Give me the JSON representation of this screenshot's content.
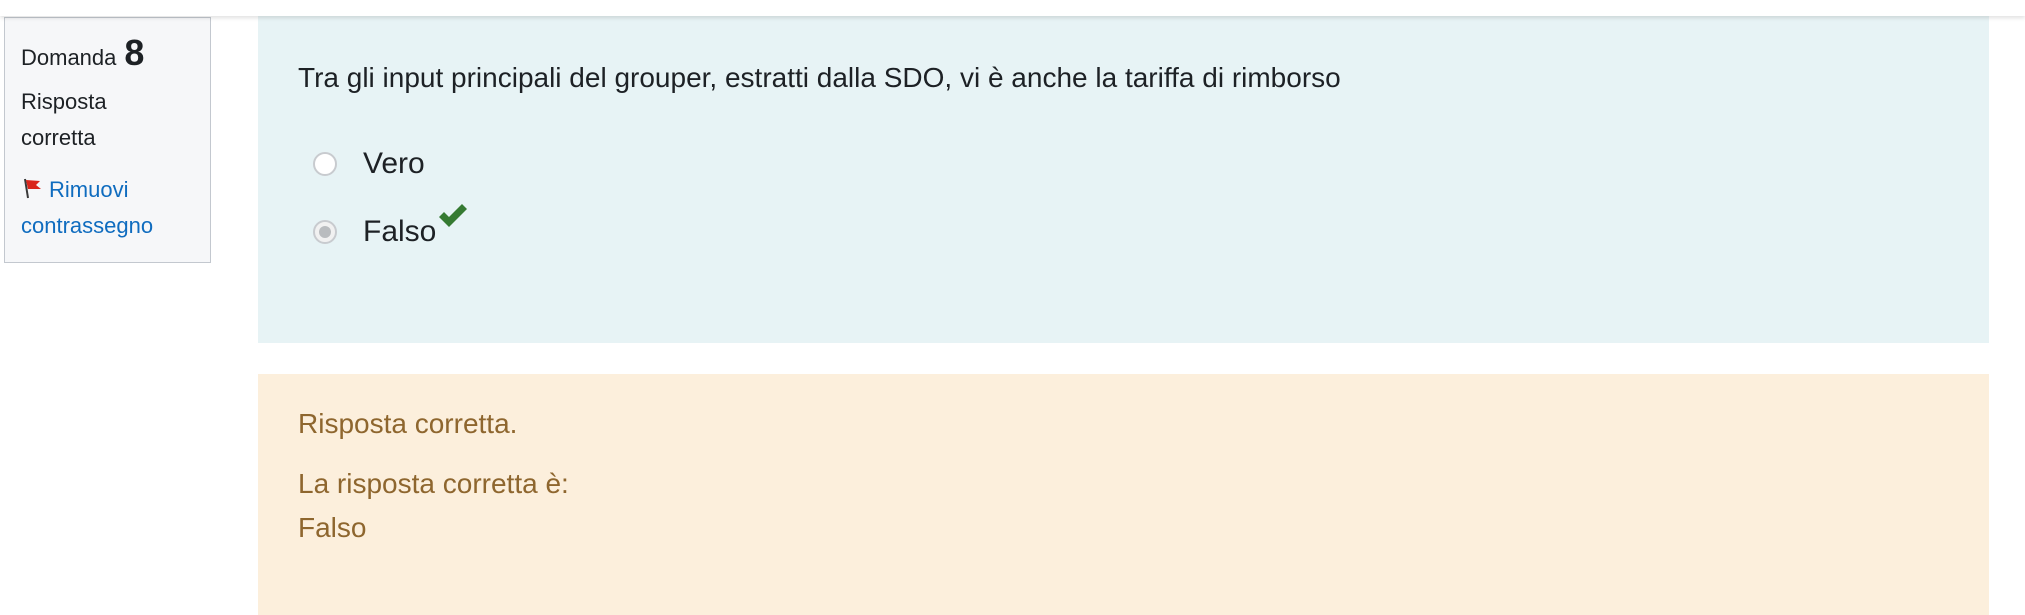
{
  "question_info": {
    "label": "Domanda",
    "number": "8",
    "state": "Risposta corretta",
    "flag_label": "Rimuovi contrassegno"
  },
  "question": {
    "text": "Tra gli input principali del grouper, estratti dalla SDO, vi è anche la tariffa di rimborso",
    "answers": [
      {
        "label": "Vero",
        "selected": false,
        "correct_mark": false
      },
      {
        "label": "Falso",
        "selected": true,
        "correct_mark": true
      }
    ]
  },
  "feedback": {
    "general": "Risposta corretta.",
    "right_answer_label": "La risposta corretta è:",
    "right_answer_value": "Falso"
  },
  "icons": {
    "flag": "flag-icon",
    "check": "check-icon"
  },
  "colors": {
    "link": "#0f6cbf",
    "formulation_bg": "#e7f3f5",
    "feedback_bg": "#fcefdc",
    "feedback_text": "#8e662e",
    "check": "#357a32",
    "flag": "#d9261c"
  }
}
